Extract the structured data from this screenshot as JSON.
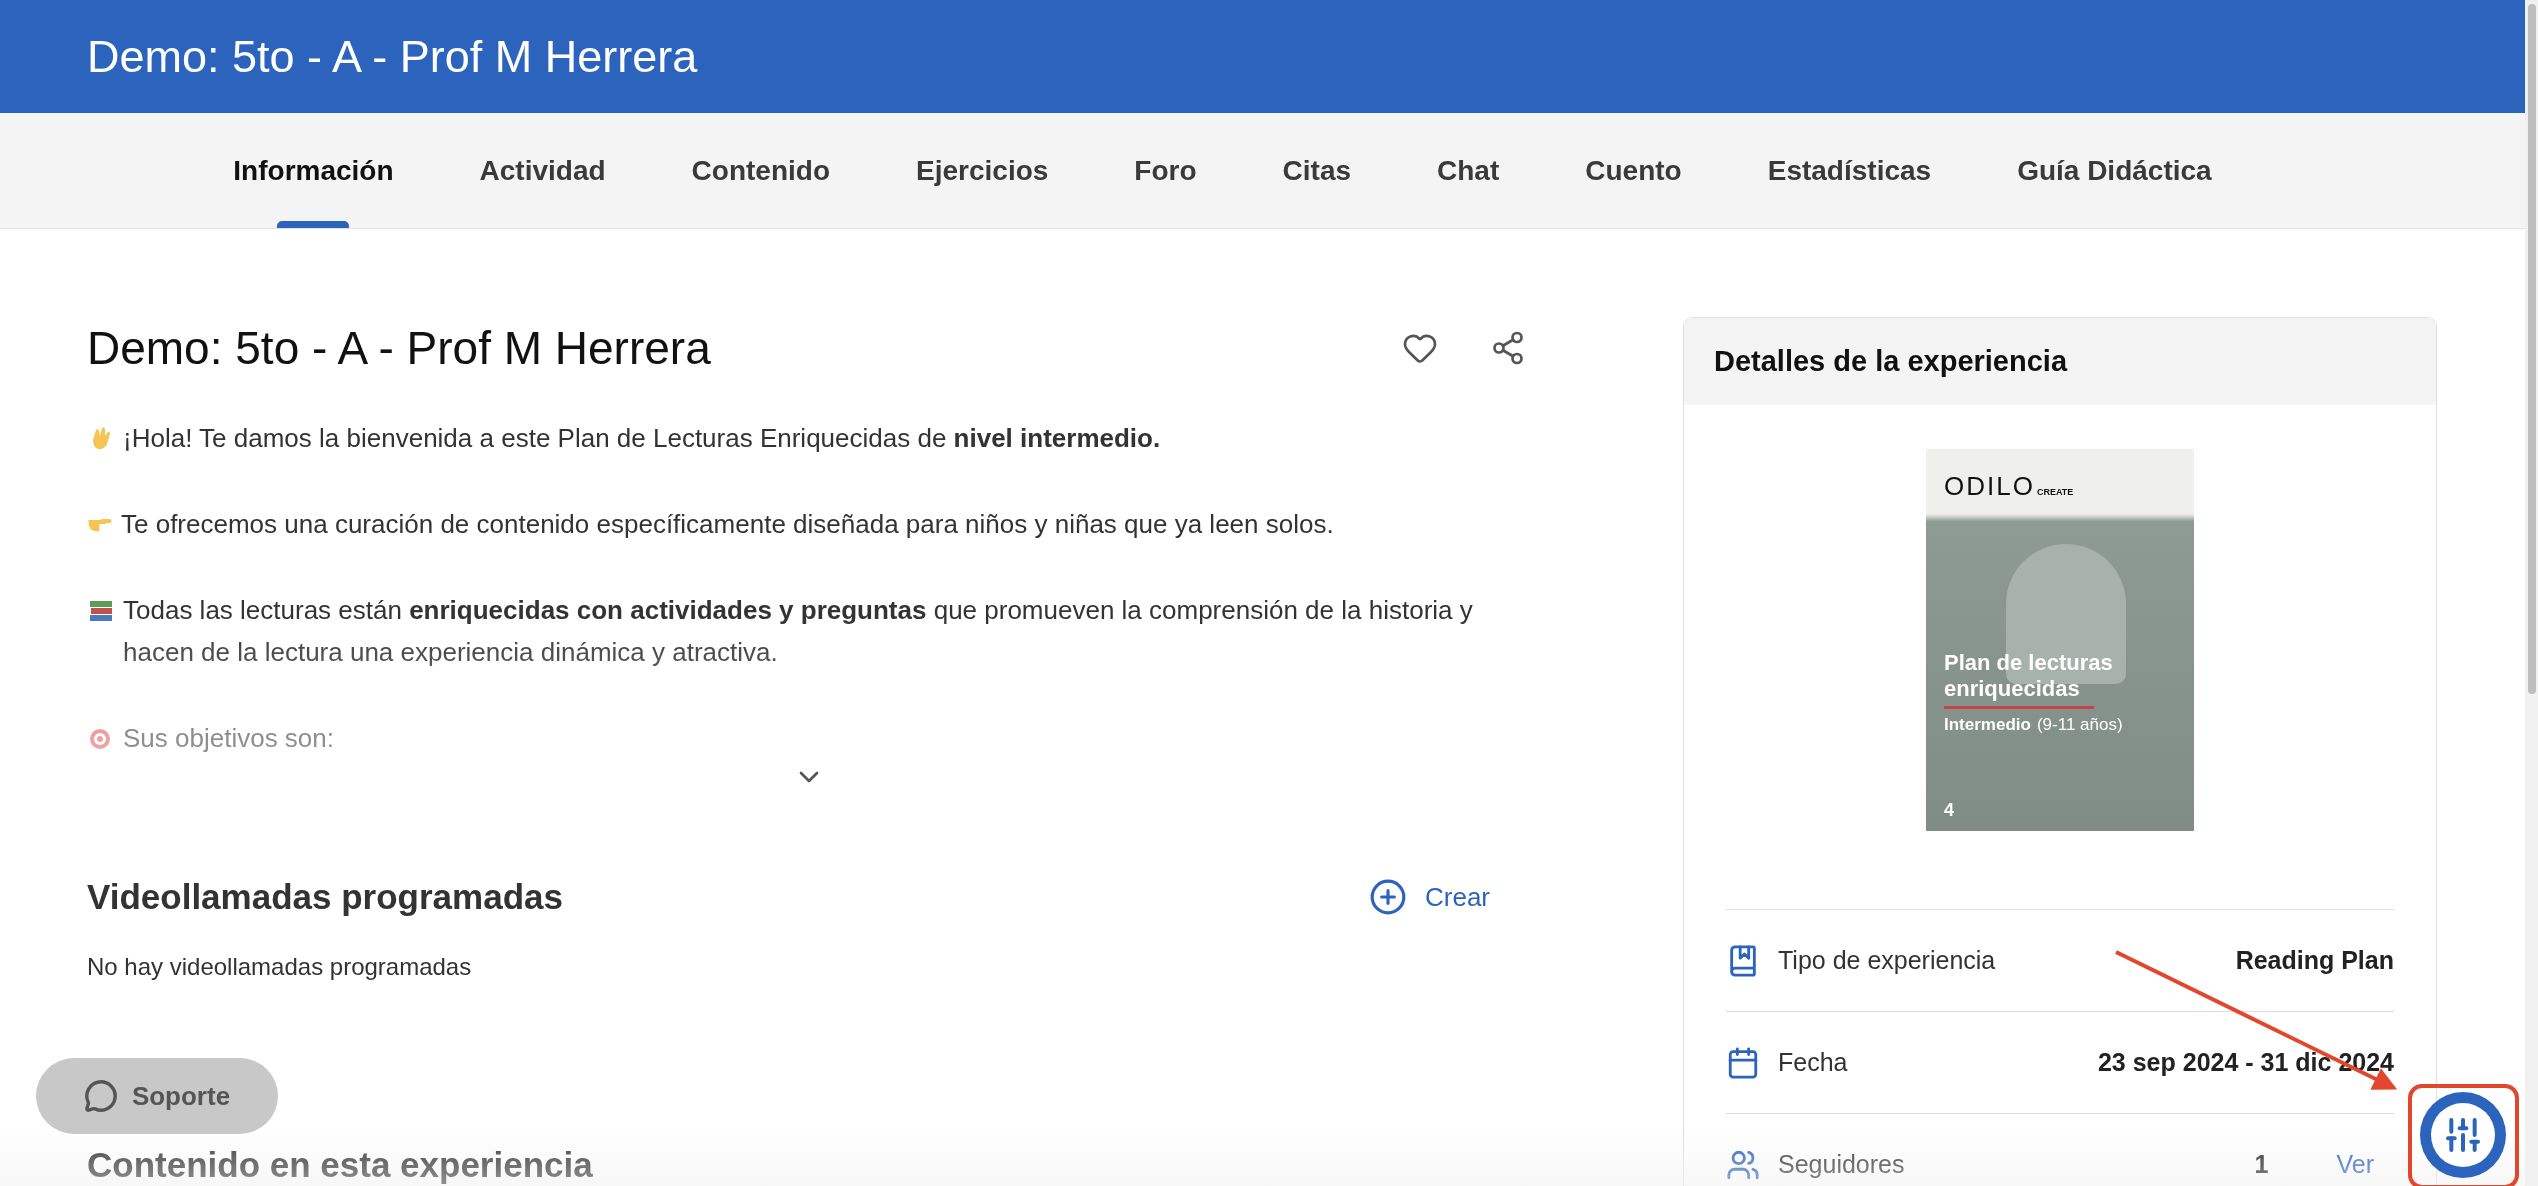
{
  "header": {
    "title": "Demo: 5to - A - Prof M Herrera"
  },
  "tabs": [
    {
      "label": "Información",
      "selected": true
    },
    {
      "label": "Actividad",
      "selected": false
    },
    {
      "label": "Contenido",
      "selected": false
    },
    {
      "label": "Ejercicios",
      "selected": false
    },
    {
      "label": "Foro",
      "selected": false
    },
    {
      "label": "Citas",
      "selected": false
    },
    {
      "label": "Chat",
      "selected": false
    },
    {
      "label": "Cuento",
      "selected": false
    },
    {
      "label": "Estadísticas",
      "selected": false
    },
    {
      "label": "Guía Didáctica",
      "selected": false
    }
  ],
  "experience": {
    "title": "Demo: 5to - A - Prof M Herrera",
    "favorite": false,
    "description": {
      "collapsed": true,
      "paragraphs": [
        {
          "kind": "wave",
          "text": "¡Hola! Te damos la bienvenida a este Plan de Lecturas Enriquecidas de **nivel intermedio.**"
        },
        {
          "kind": "point",
          "text": "Te ofrecemos una curación de contenido específicamente diseñada para niños y niñas que ya leen solos."
        },
        {
          "kind": "books",
          "text": "Todas las lecturas están **enriquecidas con actividades y preguntas** que promueven la comprensión de la historia y hacen de la lectura una experiencia dinámica y atractiva."
        },
        {
          "kind": "target",
          "text": "Sus objetivos son:"
        }
      ]
    }
  },
  "video_calls": {
    "title": "Videollamadas programadas",
    "create_label": "Crear",
    "empty_text": "No hay videollamadas programadas"
  },
  "content_section": {
    "title": "Contenido en esta experiencia"
  },
  "details": {
    "title": "Detalles de la experiencia",
    "cover": {
      "logo": "ODILO",
      "logo_suffix": "CREATE",
      "title": "Plan de lecturas enriquecidas",
      "level": "Intermedio",
      "ages": "(9-11 años)",
      "number": "4"
    },
    "rows": [
      {
        "kind": "type",
        "label": "Tipo de experiencia",
        "value": "Reading Plan"
      },
      {
        "kind": "date",
        "label": "Fecha",
        "value": "23 sep 2024 - 31 dic 2024"
      },
      {
        "kind": "followers",
        "label": "Seguidores",
        "value": "1",
        "link": "Ver"
      }
    ]
  },
  "support_button": {
    "label": "Soporte"
  }
}
